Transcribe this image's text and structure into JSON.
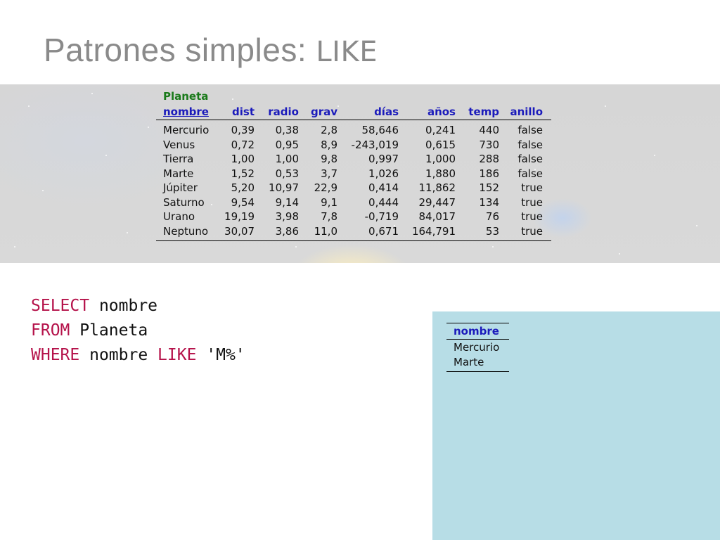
{
  "slide": {
    "title": "Patrones simples:",
    "title_keyword": "LIKE"
  },
  "table": {
    "name": "Planeta",
    "columns": [
      "nombre",
      "dist",
      "radio",
      "grav",
      "días",
      "años",
      "temp",
      "anillo"
    ],
    "rows": [
      [
        "Mercurio",
        "0,39",
        "0,38",
        "2,8",
        "58,646",
        "0,241",
        "440",
        "false"
      ],
      [
        "Venus",
        "0,72",
        "0,95",
        "8,9",
        "-243,019",
        "0,615",
        "730",
        "false"
      ],
      [
        "Tierra",
        "1,00",
        "1,00",
        "9,8",
        "0,997",
        "1,000",
        "288",
        "false"
      ],
      [
        "Marte",
        "1,52",
        "0,53",
        "3,7",
        "1,026",
        "1,880",
        "186",
        "false"
      ],
      [
        "Júpiter",
        "5,20",
        "10,97",
        "22,9",
        "0,414",
        "11,862",
        "152",
        "true"
      ],
      [
        "Saturno",
        "9,54",
        "9,14",
        "9,1",
        "0,444",
        "29,447",
        "134",
        "true"
      ],
      [
        "Urano",
        "19,19",
        "3,98",
        "7,8",
        "-0,719",
        "84,017",
        "76",
        "true"
      ],
      [
        "Neptuno",
        "30,07",
        "3,86",
        "11,0",
        "0,671",
        "164,791",
        "53",
        "true"
      ]
    ]
  },
  "query": {
    "line1_kw": "SELECT",
    "line1_rest": " nombre",
    "line2_kw": "FROM",
    "line2_rest": " Planeta",
    "line3_kw1": "WHERE",
    "line3_mid": " nombre ",
    "line3_kw2": "LIKE",
    "line3_rest": " 'M%'"
  },
  "result": {
    "column": "nombre",
    "rows": [
      "Mercurio",
      "Marte"
    ]
  },
  "colors": {
    "table_name": "#1a7a1a",
    "header": "#1b1bbb",
    "sql_keyword": "#b5124a",
    "result_panel": "#b7dde6",
    "title": "#8a8a8a"
  }
}
